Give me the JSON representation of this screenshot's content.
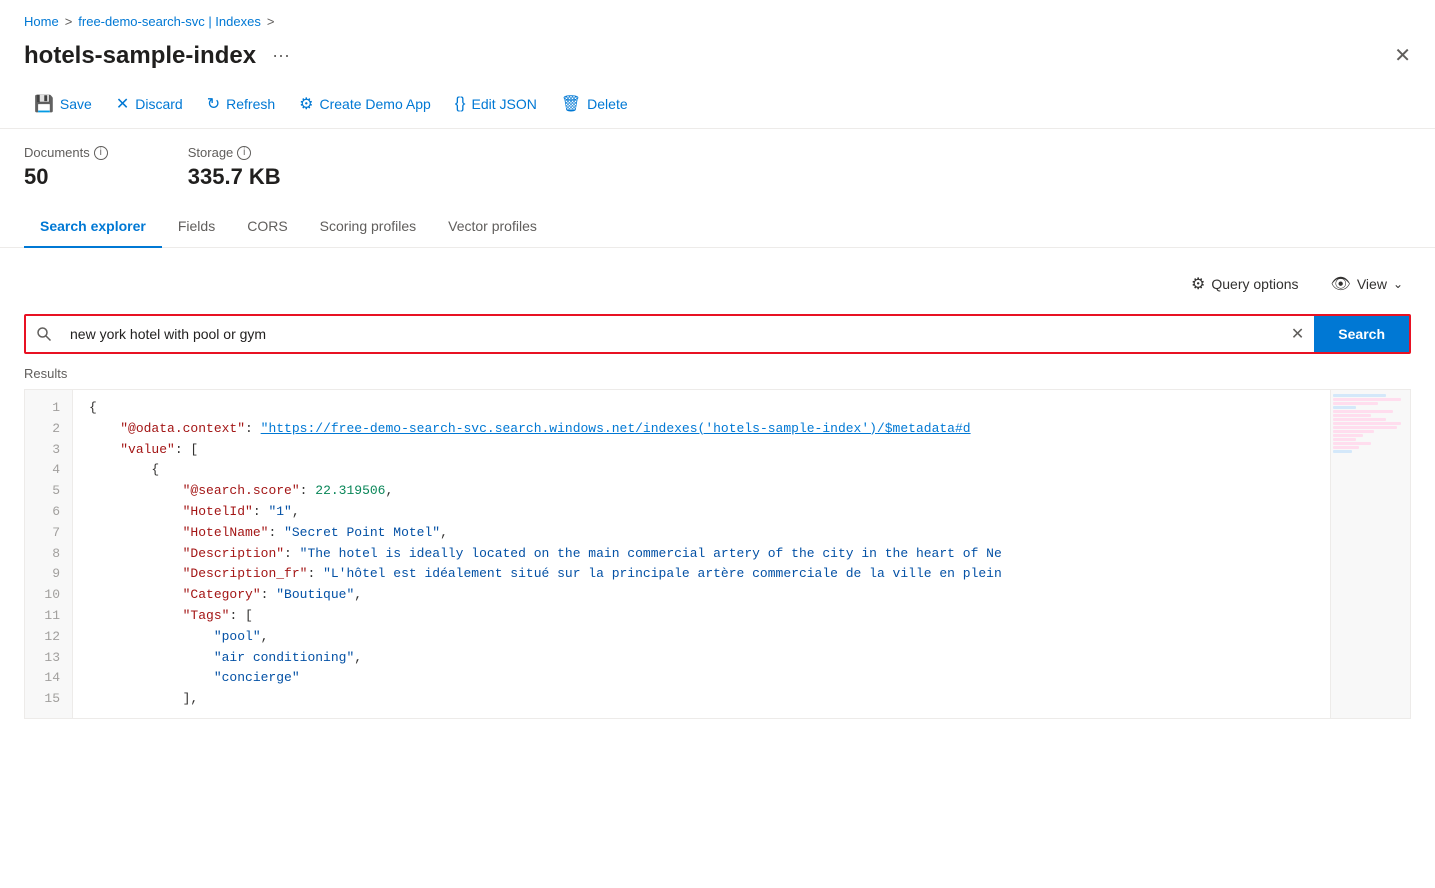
{
  "breadcrumb": {
    "home": "Home",
    "service": "free-demo-search-svc | Indexes",
    "sep1": ">",
    "sep2": ">"
  },
  "header": {
    "title": "hotels-sample-index",
    "more_label": "···",
    "close_label": "✕"
  },
  "toolbar": {
    "save_label": "Save",
    "discard_label": "Discard",
    "refresh_label": "Refresh",
    "create_demo_label": "Create Demo App",
    "edit_json_label": "Edit JSON",
    "delete_label": "Delete"
  },
  "stats": {
    "documents_label": "Documents",
    "documents_value": "50",
    "storage_label": "Storage",
    "storage_value": "335.7 KB"
  },
  "tabs": [
    {
      "id": "search-explorer",
      "label": "Search explorer",
      "active": true
    },
    {
      "id": "fields",
      "label": "Fields",
      "active": false
    },
    {
      "id": "cors",
      "label": "CORS",
      "active": false
    },
    {
      "id": "scoring-profiles",
      "label": "Scoring profiles",
      "active": false
    },
    {
      "id": "vector-profiles",
      "label": "Vector profiles",
      "active": false
    }
  ],
  "search": {
    "query_options_label": "Query options",
    "view_label": "View",
    "search_input_value": "new york hotel with pool or gym",
    "search_button_label": "Search",
    "results_label": "Results"
  },
  "json_result": {
    "url": "https://free-demo-search-svc.search.windows.net/indexes('hotels-sample-index')/$metadata#d",
    "lines": [
      {
        "num": 1,
        "content": "{"
      },
      {
        "num": 2,
        "content": "    \"@odata.context\": \"https://free-demo-search-svc.search.windows.net/indexes('hotels-sample-index')/$metadata#d"
      },
      {
        "num": 3,
        "content": "    \"value\": ["
      },
      {
        "num": 4,
        "content": "        {"
      },
      {
        "num": 5,
        "content": "            \"@search.score\": 22.319506,"
      },
      {
        "num": 6,
        "content": "            \"HotelId\": \"1\","
      },
      {
        "num": 7,
        "content": "            \"HotelName\": \"Secret Point Motel\","
      },
      {
        "num": 8,
        "content": "            \"Description\": \"The hotel is ideally located on the main commercial artery of the city in the heart of Ne"
      },
      {
        "num": 9,
        "content": "            \"Description_fr\": \"L'hôtel est idéalement situé sur la principale artère commerciale de la ville en plein"
      },
      {
        "num": 10,
        "content": "            \"Category\": \"Boutique\","
      },
      {
        "num": 11,
        "content": "            \"Tags\": ["
      },
      {
        "num": 12,
        "content": "                \"pool\","
      },
      {
        "num": 13,
        "content": "                \"air conditioning\","
      },
      {
        "num": 14,
        "content": "                \"concierge\""
      },
      {
        "num": 15,
        "content": "            ],"
      }
    ]
  }
}
